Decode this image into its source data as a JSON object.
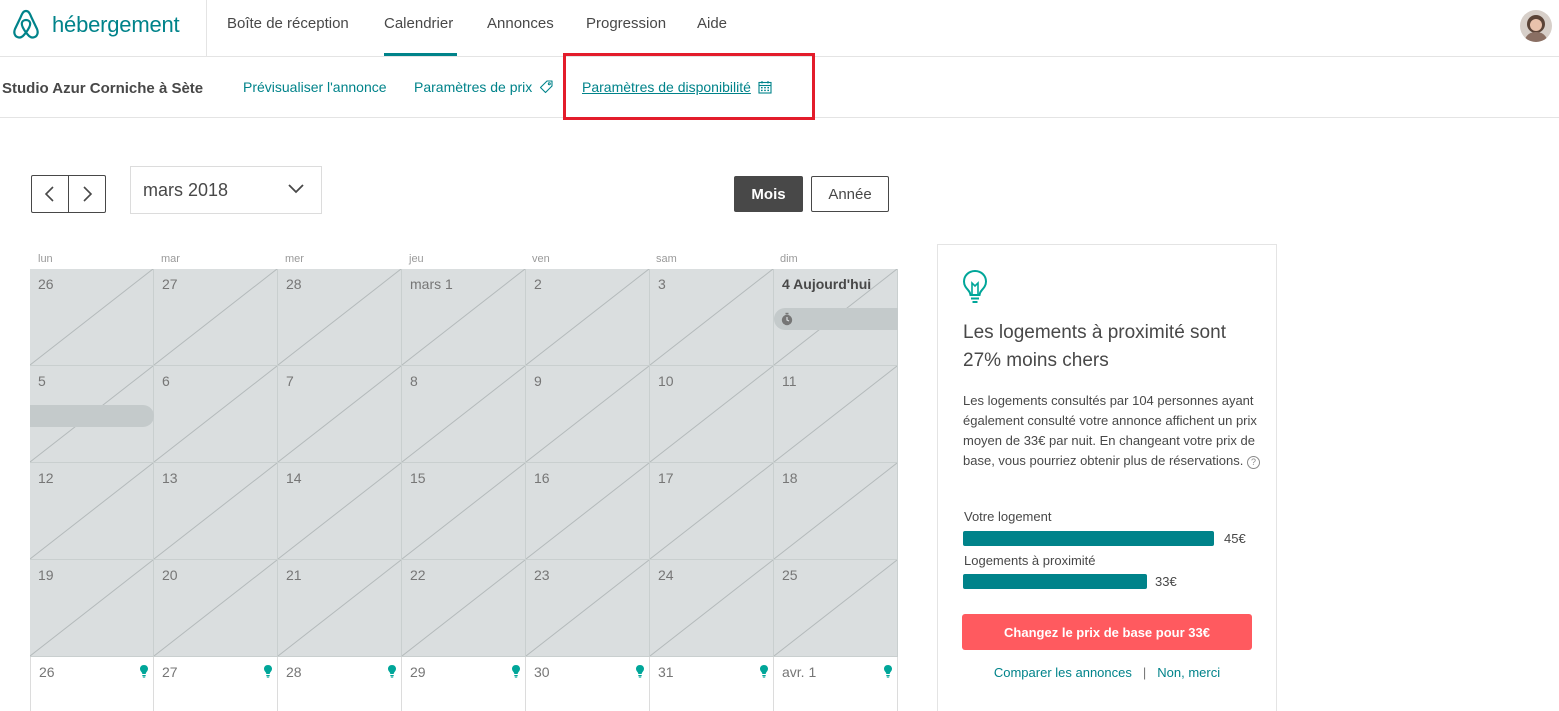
{
  "brand": {
    "name": "hébergement",
    "color": "#00838a"
  },
  "topnav": {
    "items": [
      {
        "label": "Boîte de réception",
        "active": false
      },
      {
        "label": "Calendrier",
        "active": true
      },
      {
        "label": "Annonces",
        "active": false
      },
      {
        "label": "Progression",
        "active": false
      },
      {
        "label": "Aide",
        "active": false
      }
    ]
  },
  "subnav": {
    "listing_title": "Studio Azur Corniche à Sète",
    "links": [
      {
        "label": "Prévisualiser l'annonce",
        "icon": ""
      },
      {
        "label": "Paramètres de prix",
        "icon": "price-tag-icon"
      },
      {
        "label": "Paramètres de disponibilité",
        "icon": "calendar-icon",
        "current": true
      }
    ]
  },
  "controls": {
    "month": "mars 2018",
    "view_month": "Mois",
    "view_year": "Année"
  },
  "calendar": {
    "weekdays": [
      "lun",
      "mar",
      "mer",
      "jeu",
      "ven",
      "sam",
      "dim"
    ],
    "weeks": [
      [
        "26",
        "27",
        "28",
        "mars 1",
        "2",
        "3",
        "4 Aujourd'hui"
      ],
      [
        "5",
        "6",
        "7",
        "8",
        "9",
        "10",
        "11"
      ],
      [
        "12",
        "13",
        "14",
        "15",
        "16",
        "17",
        "18"
      ],
      [
        "19",
        "20",
        "21",
        "22",
        "23",
        "24",
        "25"
      ],
      [
        "26",
        "27",
        "28",
        "29",
        "30",
        "31",
        "avr. 1"
      ]
    ]
  },
  "panel": {
    "icon": "lightbulb-icon",
    "title": "Les logements à proximité sont 27% moins chers",
    "body": "Les logements consultés par 104 personnes ayant également consulté votre annonce affichent un prix moyen de 33€ par nuit. En changeant votre prix de base, vous pourriez obtenir plus de réservations.",
    "help": "?",
    "your_label": "Votre logement",
    "your_price": "45€",
    "nearby_label": "Logements à proximité",
    "nearby_price": "33€",
    "cta": "Changez le prix de base pour 33€",
    "compare_link": "Comparer les annonces",
    "separator": "|",
    "dismiss_link": "Non, merci",
    "cta_color": "#ff5a5f"
  }
}
